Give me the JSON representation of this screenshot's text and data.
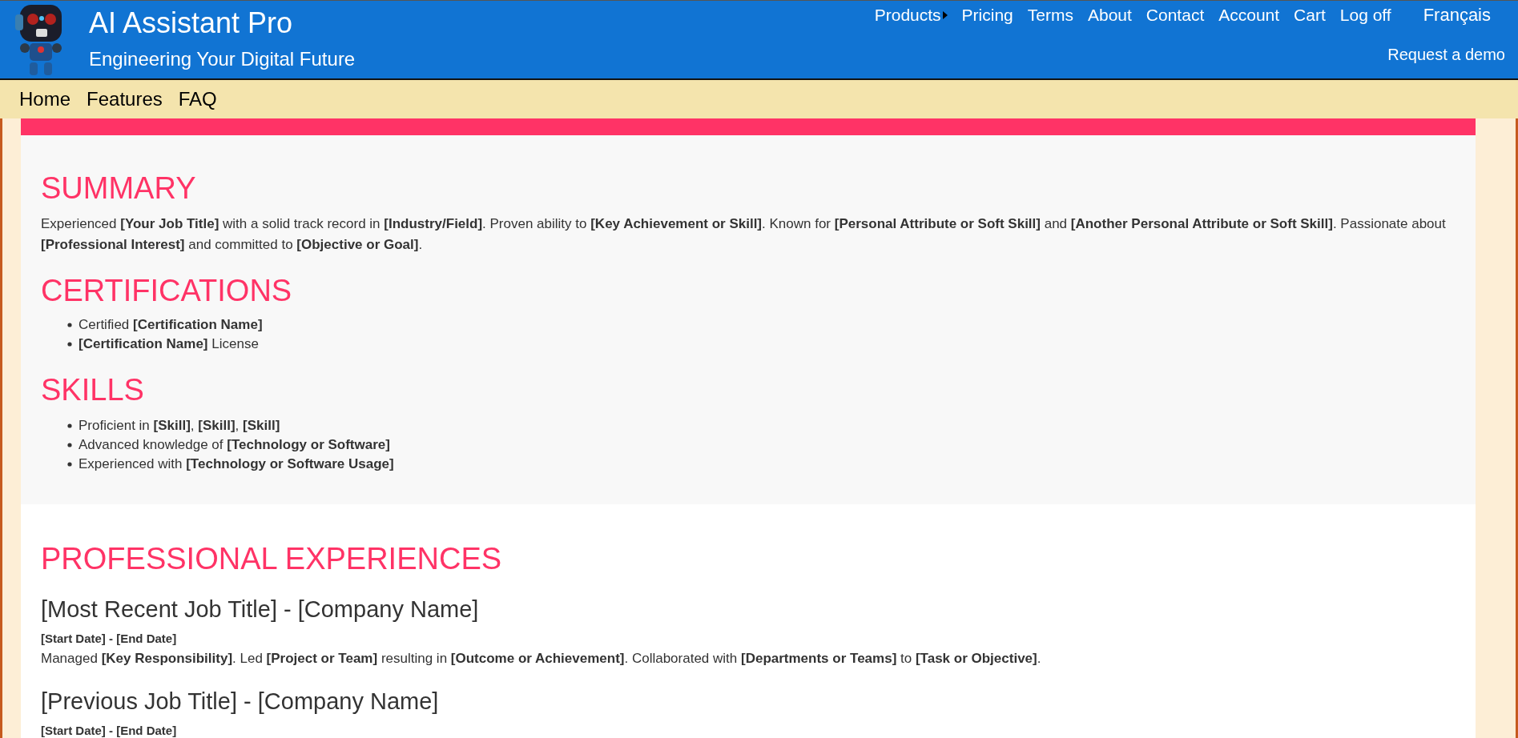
{
  "header": {
    "title": "AI Assistant Pro",
    "tagline": "Engineering Your Digital Future",
    "nav": [
      {
        "label": "Products",
        "has_submenu": true
      },
      {
        "label": "Pricing",
        "has_submenu": false
      },
      {
        "label": "Terms",
        "has_submenu": false
      },
      {
        "label": "About",
        "has_submenu": false
      },
      {
        "label": "Contact",
        "has_submenu": false
      },
      {
        "label": "Account",
        "has_submenu": false
      },
      {
        "label": "Cart",
        "has_submenu": false
      },
      {
        "label": "Log off",
        "has_submenu": false
      }
    ],
    "language": "Français",
    "demo_link": "Request a demo"
  },
  "subnav": [
    "Home",
    "Features",
    "FAQ"
  ],
  "summary": {
    "heading": "SUMMARY",
    "paragraph": "Experienced **[Your Job Title]** with a solid track record in **[Industry/Field]**. Proven ability to **[Key Achievement or Skill]**. Known for **[Personal Attribute or Soft Skill]** and **[Another Personal Attribute or Soft Skill]**. Passionate about **[Professional Interest]** and committed to **[Objective or Goal]**."
  },
  "certifications": {
    "heading": "CERTIFICATIONS",
    "items": [
      "Certified **[Certification Name]**",
      "**[Certification Name]** License"
    ]
  },
  "skills": {
    "heading": "SKILLS",
    "items": [
      "Proficient in **[Skill]**, **[Skill]**, **[Skill]**",
      "Advanced knowledge of **[Technology or Software]**",
      "Experienced with **[Technology or Software Usage]**"
    ]
  },
  "experiences": {
    "heading": "PROFESSIONAL EXPERIENCES",
    "jobs": [
      {
        "title": "[Most Recent Job Title] - [Company Name]",
        "dates": "[Start Date] - [End Date]",
        "description": "Managed **[Key Responsibility]**. Led **[Project or Team]** resulting in **[Outcome or Achievement]**. Collaborated with **[Departments or Teams]** to **[Task or Objective]**."
      },
      {
        "title": "[Previous Job Title] - [Company Name]",
        "dates": "[Start Date] - [End Date]"
      }
    ]
  }
}
